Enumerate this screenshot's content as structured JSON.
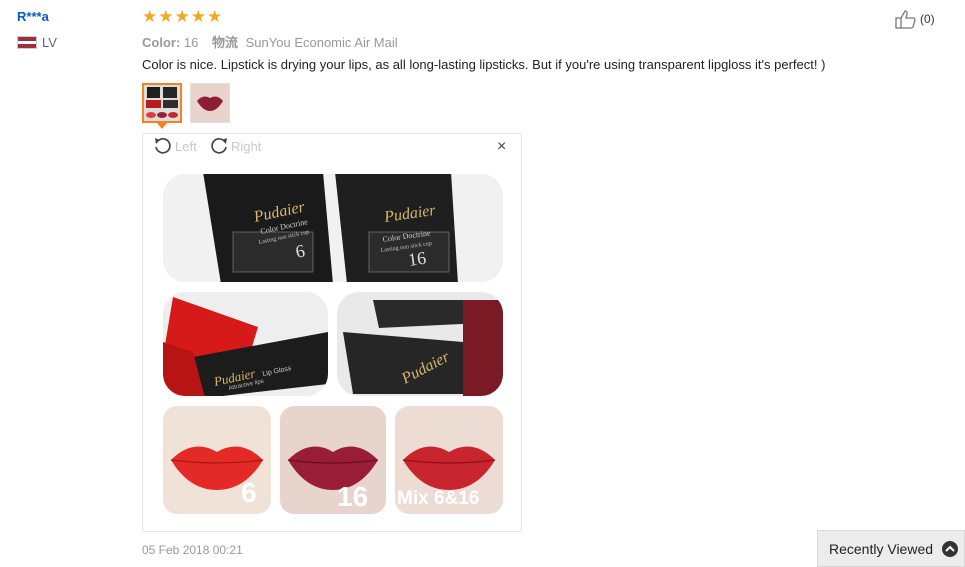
{
  "review": {
    "user_name": "R***a",
    "country_code": "LV",
    "rating": 5,
    "color_label": "Color:",
    "color_value": "16",
    "shipping_label": "物流",
    "shipping_value": "SunYou Economic Air Mail",
    "comment": "Color is nice. Lipstick is drying your lips, as all long-lasting lipsticks. But if you're using transparent lipgloss it's perfect! )",
    "helpful_count": "(0)",
    "date": "05 Feb 2018 00:21"
  },
  "viewer": {
    "rotate_left_label": "Left",
    "rotate_right_label": "Right",
    "close_glyph": "×"
  },
  "product_photo": {
    "brand": "Pudaier",
    "line": "Color Doctrine",
    "subline": "Lasting non stick cup",
    "gloss_name": "Lip Gloss",
    "gloss_sub": "Attractive lips",
    "shade_a": "6",
    "shade_b": "16",
    "shade_mix": "Mix 6&16"
  },
  "recently_viewed": {
    "label": "Recently Viewed"
  },
  "colors": {
    "link": "#0a5cc5",
    "star": "#f5a623",
    "accent": "#f48220",
    "flag_red": "#9e3039"
  },
  "icons": {
    "rating": "star-icon",
    "helpful": "thumbs-up-icon",
    "rotate_left": "rotate-left-icon",
    "rotate_right": "rotate-right-icon",
    "close": "close-icon",
    "up": "chevron-up-icon"
  }
}
